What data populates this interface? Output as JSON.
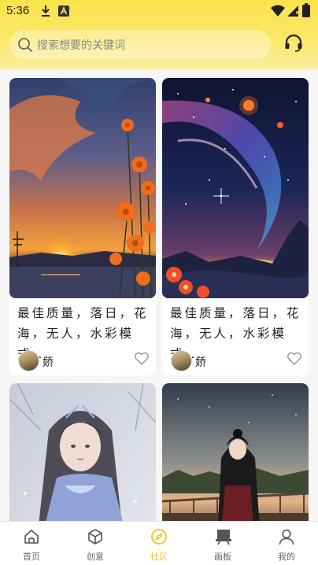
{
  "status_bar": {
    "time": "5:36",
    "icons": [
      "download-icon",
      "notification-a-icon",
      "wifi-icon",
      "signal-icon",
      "battery-icon"
    ]
  },
  "search": {
    "placeholder": "搜索想要的关键词",
    "icon": "search-icon"
  },
  "header": {
    "support_icon": "headset-icon",
    "accent_color": "#fbe34a"
  },
  "feed": {
    "cards": [
      {
        "title": "最佳质量，落日，花海，无人，水彩模式...",
        "author": "娇",
        "artwork": "sunset-flowers-artwork"
      },
      {
        "title": "最佳质量，落日，花海，无人，水彩模式...",
        "author": "娇",
        "artwork": "galaxy-sunset-artwork"
      },
      {
        "title": "",
        "author": "",
        "artwork": "winter-girl-artwork"
      },
      {
        "title": "",
        "author": "",
        "artwork": "bridge-girl-artwork"
      }
    ]
  },
  "nav": {
    "items": [
      {
        "label": "首页",
        "icon": "home-icon"
      },
      {
        "label": "创意",
        "icon": "cube-icon"
      },
      {
        "label": "社区",
        "icon": "compass-icon",
        "active": true
      },
      {
        "label": "画板",
        "icon": "easel-icon"
      },
      {
        "label": "我的",
        "icon": "person-icon"
      }
    ],
    "active_color": "#f2c40f"
  }
}
